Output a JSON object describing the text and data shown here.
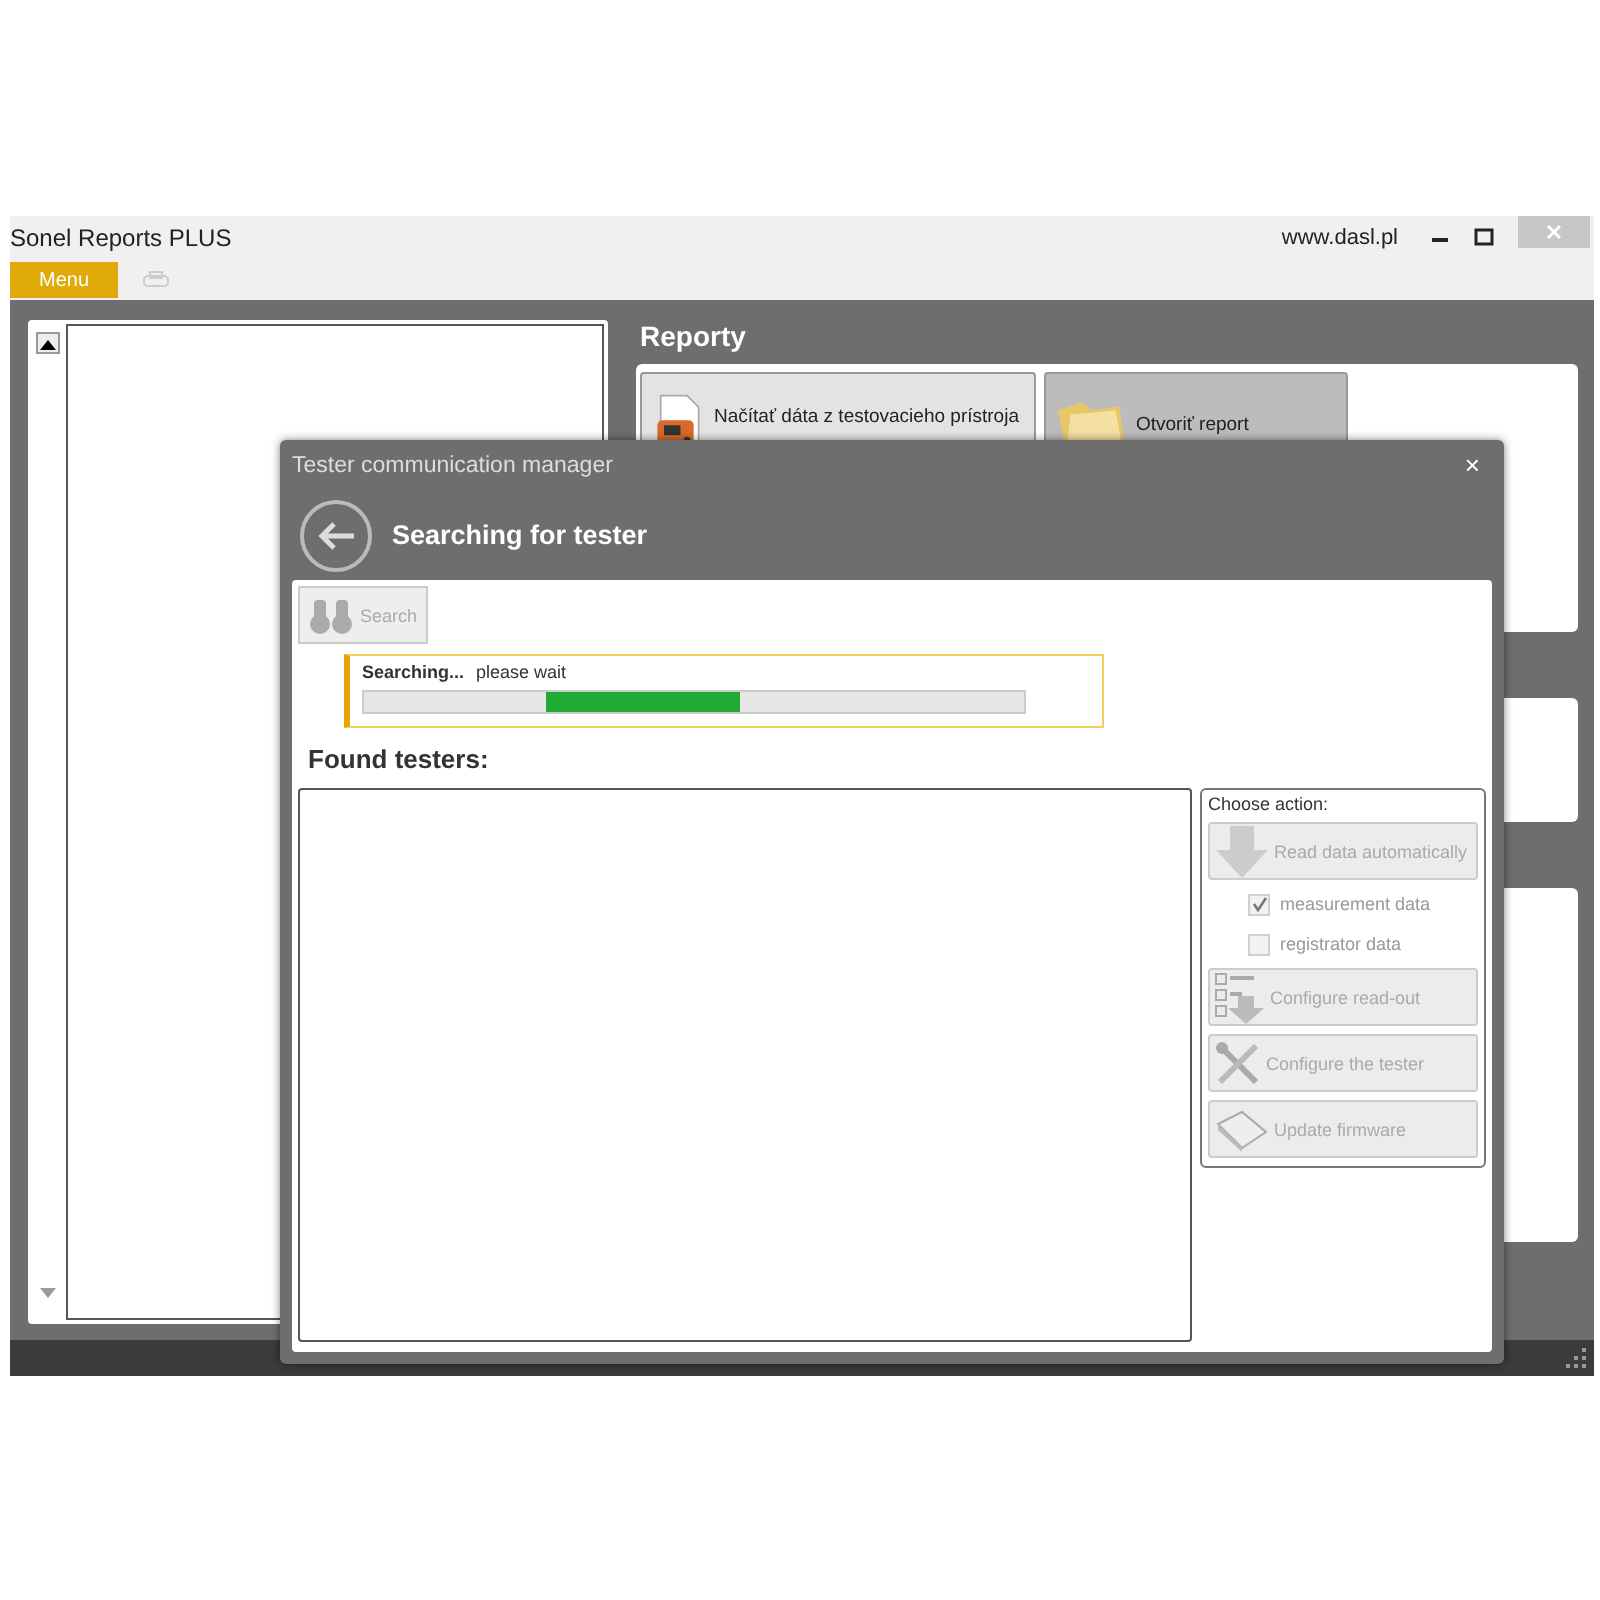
{
  "window": {
    "title": "Sonel Reports PLUS",
    "website": "www.dasl.pl"
  },
  "menu_button": "Menu",
  "reports": {
    "heading": "Reporty",
    "tiles": [
      {
        "label": "Načítať dáta z testovacieho prístroja",
        "kind": "device"
      },
      {
        "label": "Otvoriť report",
        "kind": "folder"
      }
    ]
  },
  "dialog": {
    "title": "Tester communication manager",
    "close": "×",
    "heading": "Searching for tester",
    "search_button": {
      "label": "Search",
      "disabled": true
    },
    "status": {
      "label": "Searching...",
      "message": "please wait",
      "indeterminate": true
    },
    "found_heading": "Found testers:",
    "actions": {
      "legend": "Choose action:",
      "items": [
        {
          "kind": "button",
          "label": "Read data automatically",
          "disabled": true
        },
        {
          "kind": "checkbox",
          "label": "measurement data",
          "checked": true,
          "disabled": true
        },
        {
          "kind": "checkbox",
          "label": "registrator data",
          "checked": false,
          "disabled": true
        },
        {
          "kind": "button",
          "label": "Configure read-out",
          "disabled": true
        },
        {
          "kind": "button",
          "label": "Configure the tester",
          "disabled": true
        },
        {
          "kind": "button",
          "label": "Update firmware",
          "disabled": true
        }
      ]
    }
  }
}
